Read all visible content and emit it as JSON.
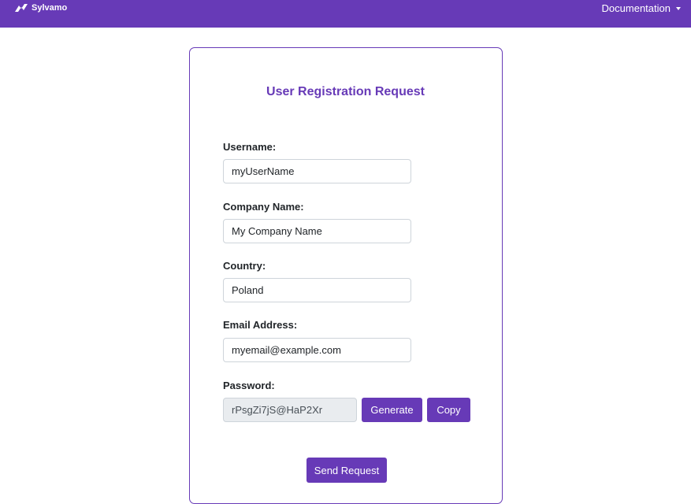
{
  "navbar": {
    "brand": "Sylvamo",
    "brand_icon": "sylvamo-logo-icon",
    "documentation_label": "Documentation",
    "color": "#673ab7"
  },
  "form": {
    "title": "User Registration Request",
    "fields": {
      "username": {
        "label": "Username:",
        "value": "myUserName"
      },
      "company": {
        "label": "Company Name:",
        "value": "My Company Name"
      },
      "country": {
        "label": "Country:",
        "value": "Poland"
      },
      "email": {
        "label": "Email Address:",
        "value": "myemail@example.com"
      },
      "password": {
        "label": "Password:",
        "value": "rPsgZi7jS@HaP2Xr"
      }
    },
    "generate_label": "Generate",
    "copy_label": "Copy",
    "submit_label": "Send Request"
  }
}
